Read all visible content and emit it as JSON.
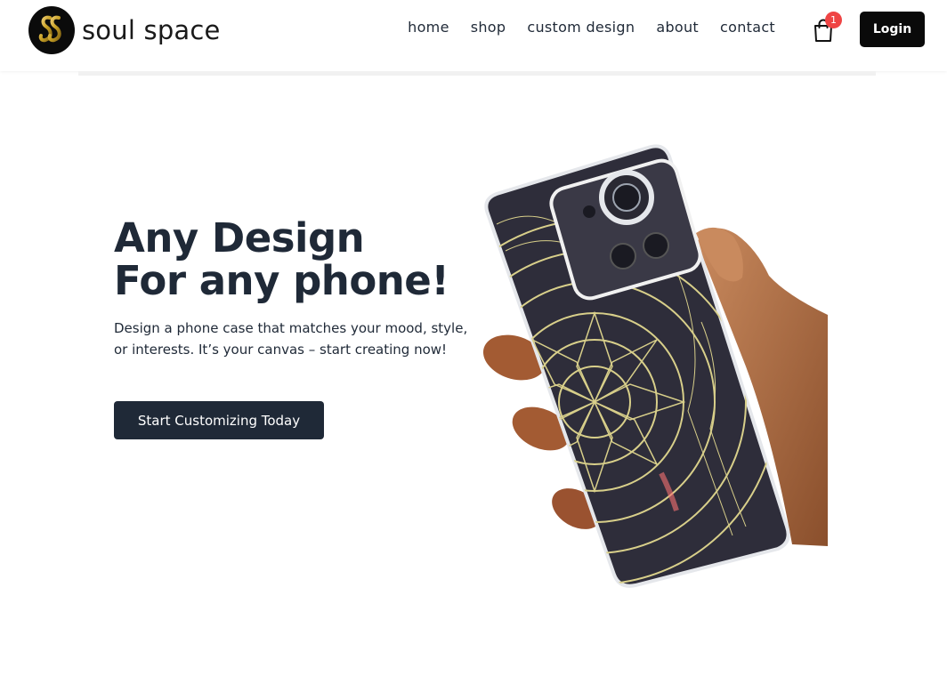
{
  "brand": {
    "name": "soul space",
    "logo_icon": "ss-monogram-icon"
  },
  "nav": {
    "items": [
      {
        "label": "home"
      },
      {
        "label": "shop"
      },
      {
        "label": "custom design"
      },
      {
        "label": "about"
      },
      {
        "label": "contact"
      }
    ]
  },
  "cart": {
    "icon": "shopping-bag-icon",
    "count": "1"
  },
  "header": {
    "login_label": "Login"
  },
  "hero": {
    "title_line1": "Any Design",
    "title_line2": "For any phone!",
    "description": "Design a phone case that matches your mood, style, or interests. It’s your canvas – start creating now!",
    "cta_label": "Start Customizing Today"
  },
  "colors": {
    "primary_dark": "#1f2937",
    "login_bg": "#0a0a0a",
    "badge_red": "#ef4444",
    "logo_gold": "#c9a227",
    "mandala_gold": "#d8cf8a"
  }
}
